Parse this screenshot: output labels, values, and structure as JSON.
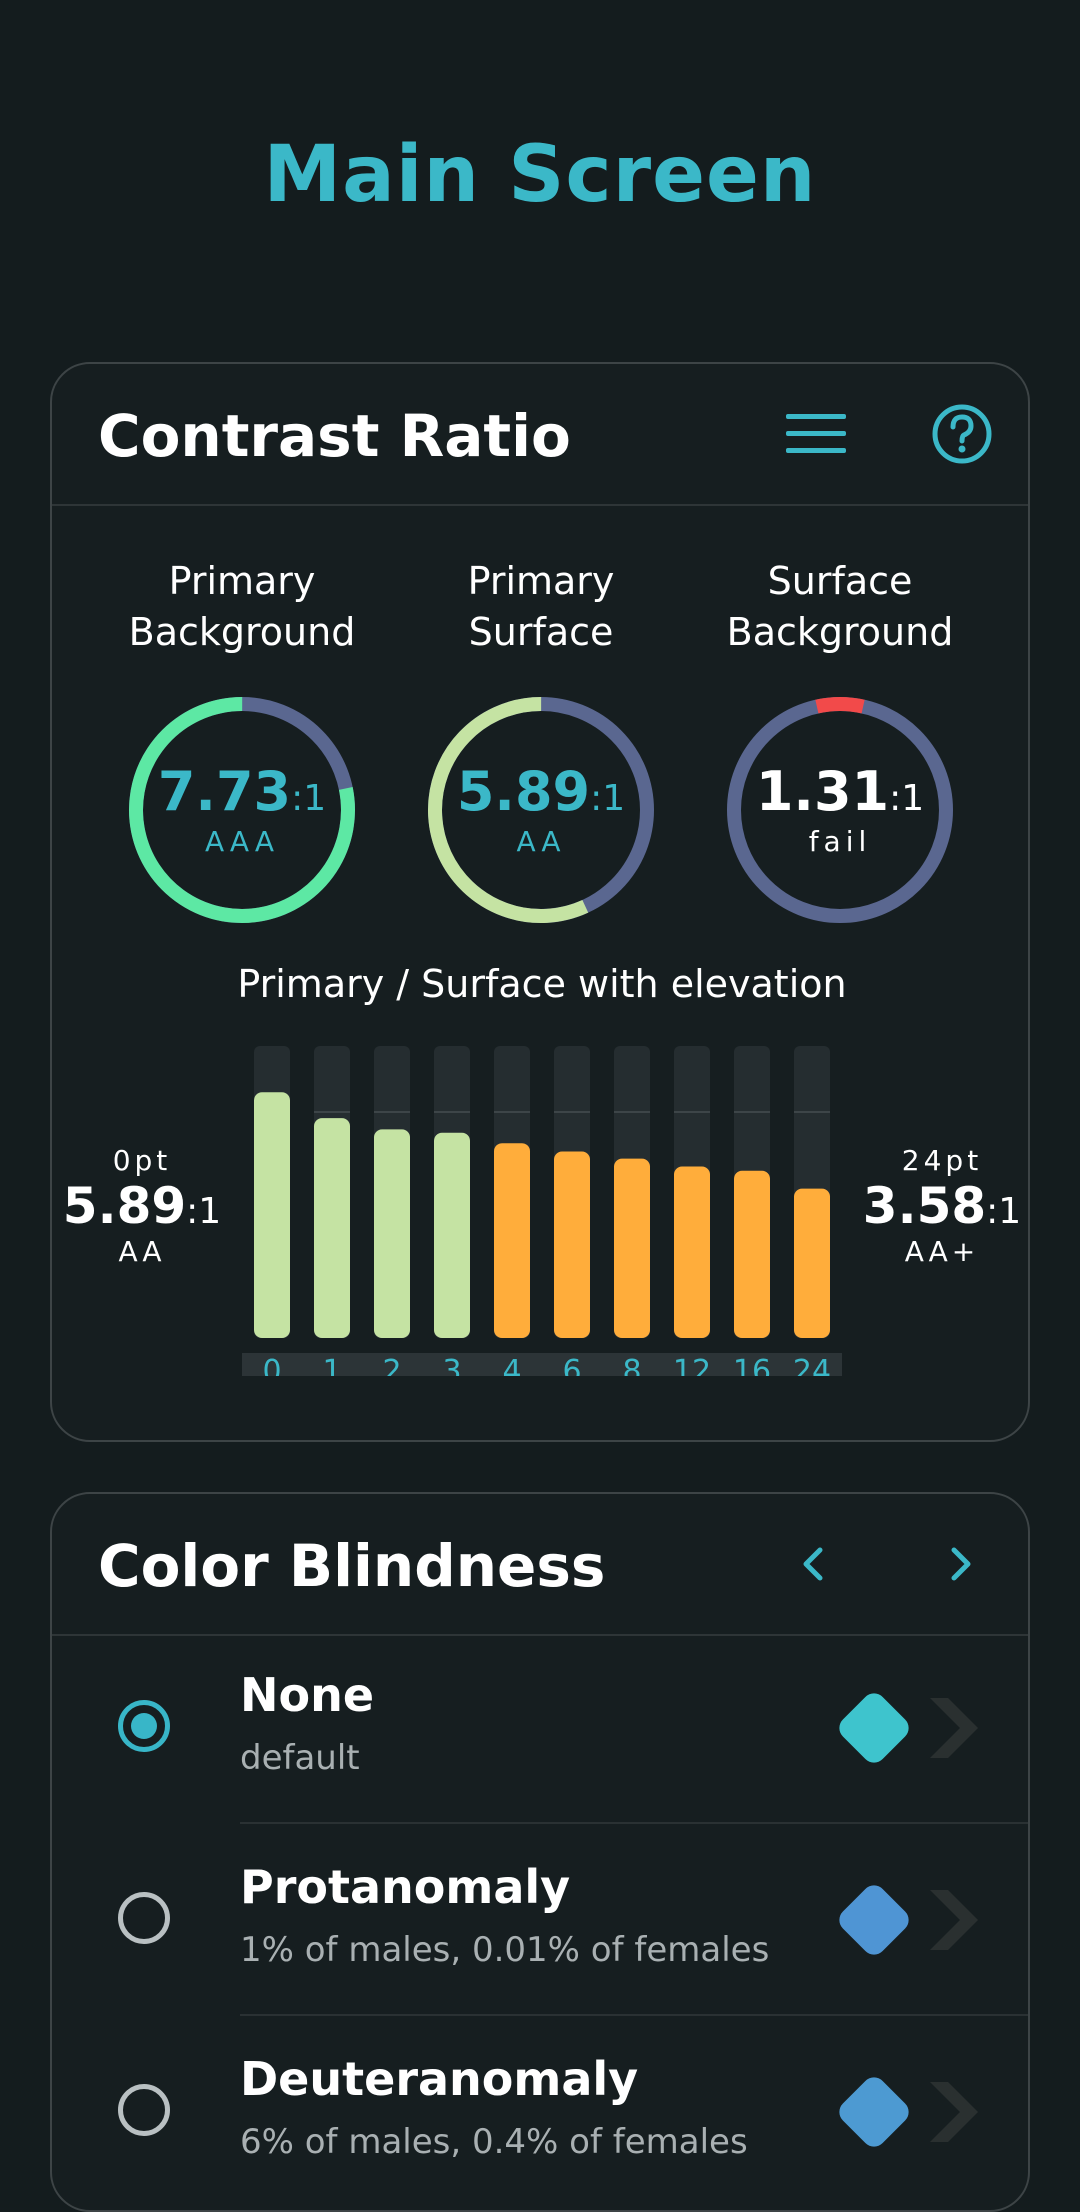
{
  "screen_title": "Main Screen",
  "contrast": {
    "title": "Contrast Ratio",
    "gauges": [
      {
        "label_line1": "Primary",
        "label_line2": "Background",
        "value": "7.73",
        "suffix": ":1",
        "grade": "AAA",
        "ratio": 7.73,
        "fill_color": "#5de8a4",
        "value_color": "#3bb8c8"
      },
      {
        "label_line1": "Primary",
        "label_line2": "Surface",
        "value": "5.89",
        "suffix": ":1",
        "grade": "AA",
        "ratio": 5.89,
        "fill_color": "#c5e3a3",
        "value_color": "#3bb8c8"
      },
      {
        "label_line1": "Surface",
        "label_line2": "Background",
        "value": "1.31",
        "suffix": ":1",
        "grade": "fail",
        "ratio": 1.31,
        "fill_color": "#f24a4a",
        "value_color": "#ffffff"
      }
    ],
    "elevation_title": "Primary / Surface with elevation",
    "left": {
      "pt": "0pt",
      "value": "5.89",
      "suffix": ":1",
      "grade": "AA"
    },
    "right": {
      "pt": "24pt",
      "value": "3.58",
      "suffix": ":1",
      "grade": "AA+"
    },
    "elevation_labels": [
      "0",
      "1",
      "2",
      "3",
      "4",
      "6",
      "8",
      "12",
      "16",
      "24"
    ],
    "elevation_ratios": [
      5.89,
      5.27,
      5.0,
      4.92,
      4.67,
      4.47,
      4.3,
      4.11,
      4.01,
      3.58
    ]
  },
  "colors": {
    "accent": "#3bb8c8",
    "track": "#5a6790",
    "bar_pass": "#c5e3a3",
    "bar_mid": "#ffad3b"
  },
  "blindness": {
    "title": "Color Blindness",
    "rows": [
      {
        "name": "None",
        "desc": "default",
        "selected": true,
        "swatch": "#3ec4cd"
      },
      {
        "name": "Protanomaly",
        "desc": "1% of males, 0.01% of females",
        "selected": false,
        "swatch": "#4f95d4"
      },
      {
        "name": "Deuteranomaly",
        "desc": "6% of males, 0.4% of females",
        "selected": false,
        "swatch": "#4d9ad2"
      }
    ]
  },
  "icons": {
    "menu": "menu-icon",
    "help": "help-icon",
    "prev": "chevron-left-icon",
    "next": "chevron-right-icon"
  }
}
